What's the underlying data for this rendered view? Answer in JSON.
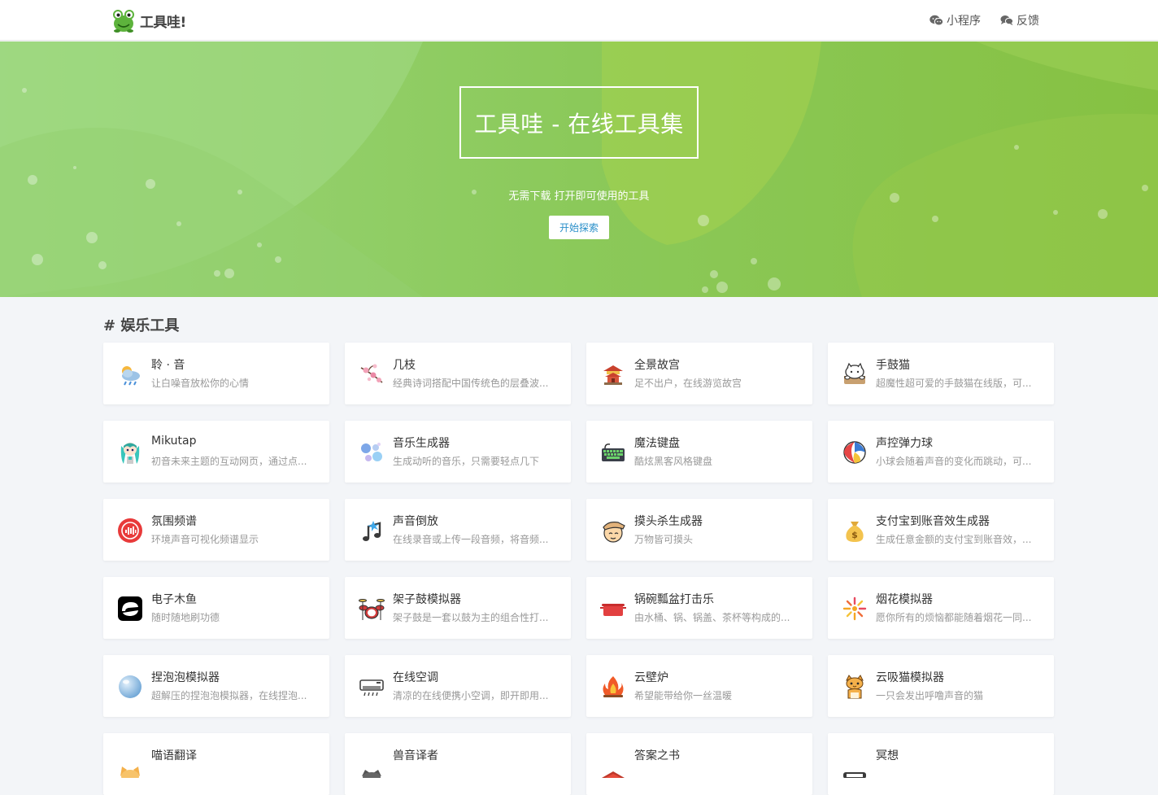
{
  "header": {
    "brand": "工具哇!",
    "nav": [
      {
        "label": "小程序",
        "icon": "wechat-icon"
      },
      {
        "label": "反馈",
        "icon": "chat-bubbles-icon"
      }
    ]
  },
  "hero": {
    "title": "工具哇 - 在线工具集",
    "subtitle": "无需下载 打开即可使用的工具",
    "button": "开始探索"
  },
  "section": {
    "title": "# 娱乐工具"
  },
  "colors": {
    "hero_green": "#8ccb5e",
    "accent_blue": "#2a8fc9"
  },
  "tools": [
    {
      "title": "聆 · 音",
      "desc": "让白噪音放松你的心情",
      "icon": "rain-cloud-icon"
    },
    {
      "title": "几枝",
      "desc": "经典诗词搭配中国传统色的层叠波...",
      "icon": "plum-blossom-icon"
    },
    {
      "title": "全景故宫",
      "desc": "足不出户，在线游览故宫",
      "icon": "palace-icon"
    },
    {
      "title": "手鼓猫",
      "desc": "超魔性超可爱的手鼓猫在线版，可...",
      "icon": "bongo-cat-icon"
    },
    {
      "title": "Mikutap",
      "desc": "初音未来主题的互动网页，通过点...",
      "icon": "miku-icon"
    },
    {
      "title": "音乐生成器",
      "desc": "生成动听的音乐，只需要轻点几下",
      "icon": "music-dots-icon"
    },
    {
      "title": "魔法键盘",
      "desc": "酷炫黑客风格键盘",
      "icon": "keyboard-icon"
    },
    {
      "title": "声控弹力球",
      "desc": "小球会随着声音的变化而跳动，可...",
      "icon": "beach-ball-icon"
    },
    {
      "title": "氛围频谱",
      "desc": "环境声音可视化频谱显示",
      "icon": "spectrum-icon"
    },
    {
      "title": "声音倒放",
      "desc": "在线录音或上传一段音频，将音频...",
      "icon": "music-note-icon"
    },
    {
      "title": "摸头杀生成器",
      "desc": "万物皆可摸头",
      "icon": "pat-head-icon"
    },
    {
      "title": "支付宝到账音效生成器",
      "desc": "生成任意金额的支付宝到账音效，...",
      "icon": "money-bag-icon"
    },
    {
      "title": "电子木鱼",
      "desc": "随时随地刷功德",
      "icon": "wooden-fish-icon"
    },
    {
      "title": "架子鼓模拟器",
      "desc": "架子鼓是一套以鼓为主的组合性打...",
      "icon": "drum-kit-icon"
    },
    {
      "title": "锅碗瓢盆打击乐",
      "desc": "由水桶、锅、锅盖、茶杯等构成的...",
      "icon": "pot-icon"
    },
    {
      "title": "烟花模拟器",
      "desc": "愿你所有的烦恼都能随着烟花一同...",
      "icon": "firework-icon"
    },
    {
      "title": "捏泡泡模拟器",
      "desc": "超解压的捏泡泡模拟器，在线捏泡...",
      "icon": "bubble-icon"
    },
    {
      "title": "在线空调",
      "desc": "清凉的在线便携小空调，即开即用...",
      "icon": "air-conditioner-icon"
    },
    {
      "title": "云壁炉",
      "desc": "希望能带给你一丝温暖",
      "icon": "fireplace-icon"
    },
    {
      "title": "云吸猫模拟器",
      "desc": "一只会发出呼噜声音的猫",
      "icon": "cat-icon"
    },
    {
      "title": "喵语翻译",
      "desc": "",
      "icon": "cat-face-icon"
    },
    {
      "title": "兽音译者",
      "desc": "",
      "icon": "beast-icon"
    },
    {
      "title": "答案之书",
      "desc": "",
      "icon": "book-icon"
    },
    {
      "title": "冥想",
      "desc": "",
      "icon": "meditation-icon"
    }
  ]
}
